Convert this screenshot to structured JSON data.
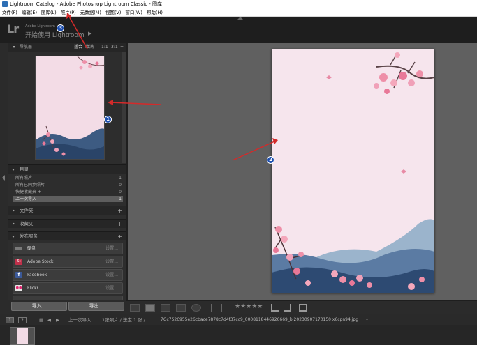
{
  "window": {
    "title": "Lightroom Catalog - Adobe Photoshop Lightroom Classic - 图库"
  },
  "menubar": {
    "items": [
      "文件(F)",
      "编辑(E)",
      "图库(L)",
      "照片(P)",
      "元数据(M)",
      "视图(V)",
      "窗口(W)",
      "帮助(H)"
    ]
  },
  "header": {
    "logo": "Lr",
    "brand": "Adobe Lightroom",
    "status": "开始使用 Lightroom",
    "arrow": "▶"
  },
  "navigator": {
    "title": "导航器",
    "zoom_options": [
      "适合",
      "填满",
      "1:1",
      "3:1",
      "÷"
    ]
  },
  "catalog": {
    "title": "目录",
    "rows": [
      {
        "label": "所有照片",
        "count": "1"
      },
      {
        "label": "所有已同步照片",
        "count": "0"
      },
      {
        "label": "快捷收藏夹 +",
        "count": "0"
      },
      {
        "label": "上一次导入",
        "count": "1"
      }
    ]
  },
  "panels": {
    "folders": "文件夹",
    "collections": "收藏夹",
    "publish": "发布服务",
    "plus": "+"
  },
  "publish_services": [
    {
      "label": "硬盘",
      "action": "设置...",
      "icon_color": "#7a7a7a",
      "icon_text": ""
    },
    {
      "label": "Adobe Stock",
      "action": "设置...",
      "icon_color": "#c0304a",
      "icon_text": "St"
    },
    {
      "label": "Facebook",
      "action": "设置...",
      "icon_color": "#3b5998",
      "icon_text": "f"
    },
    {
      "label": "Flickr",
      "action": "设置...",
      "icon_color": "#e8e8e8",
      "icon_text": "●●"
    }
  ],
  "left_buttons": {
    "import": "导入...",
    "export": "导出..."
  },
  "toolbar": {
    "stars": "★★★★★"
  },
  "filmstrip_bar": {
    "page1": "1",
    "page2": "2",
    "source": "上一次导入",
    "count": "1张照片 / 选定 1 张 /",
    "filename": "7Gc7526955e26cbace7878c7d4f37cc9_0008118446926669_b 20230907170150 x6cpn94.jpg",
    "filename_arrow": "▾"
  },
  "annotations": {
    "one": "1",
    "two": "2",
    "three": "3"
  },
  "colors": {
    "annotation_blue": "#1e4fae",
    "arrow_red": "#d42a2a",
    "photo_pink": "#f5e3eb"
  }
}
